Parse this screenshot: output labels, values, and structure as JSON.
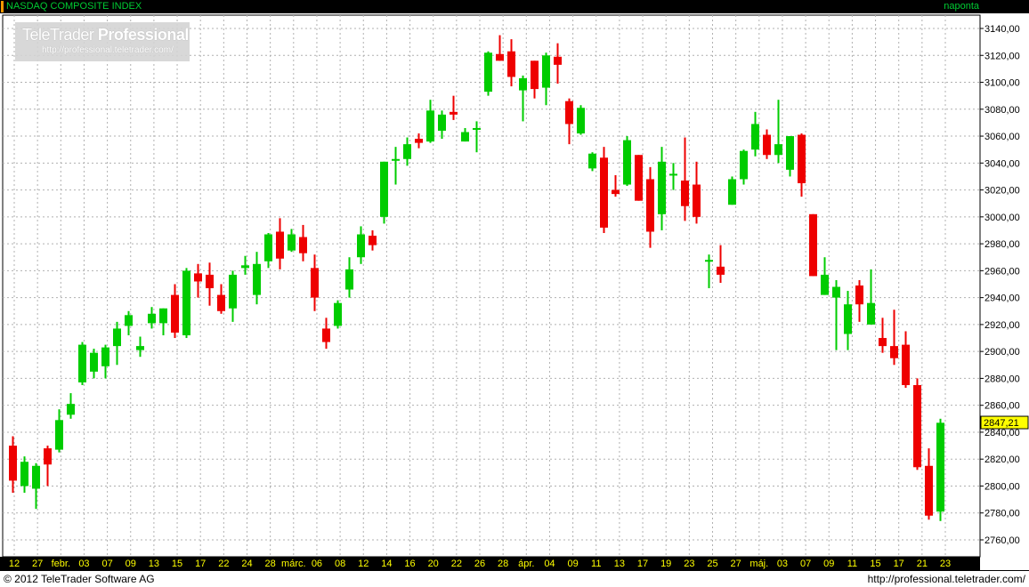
{
  "header": {
    "title": "NASDAQ COMPOSITE INDEX",
    "interval": "naponta"
  },
  "footer": {
    "copyright": "© 2012 TeleTrader Software AG",
    "url": "http://professional.teletrader.com/"
  },
  "watermark": {
    "brand": "TeleTrader",
    "brand_bold": "Professional",
    "url": "http://professional.teletrader.com/"
  },
  "colors": {
    "up": "#00cc00",
    "down": "#ee0000",
    "title_text": "#00cc33",
    "last_price_bg": "#ffff00",
    "accent": "#ff9900"
  },
  "chart_data": {
    "type": "candlestick",
    "y_axis": {
      "min": 2750,
      "max": 3150,
      "ticks": [
        2760,
        2780,
        2800,
        2820,
        2840,
        2860,
        2880,
        2900,
        2920,
        2940,
        2960,
        2980,
        3000,
        3020,
        3040,
        3060,
        3080,
        3100,
        3120,
        3140
      ],
      "tick_labels": [
        "2760,00",
        "2780,00",
        "2800,00",
        "2820,00",
        "2840,00",
        "2860,00",
        "2880,00",
        "2900,00",
        "2920,00",
        "2940,00",
        "2960,00",
        "2980,00",
        "3000,00",
        "3020,00",
        "3040,00",
        "3060,00",
        "3080,00",
        "3100,00",
        "3120,00",
        "3140,00"
      ],
      "position": "right",
      "grid": true
    },
    "x_axis": {
      "tick_labels": [
        "12",
        "27",
        "febr.",
        "03",
        "07",
        "09",
        "13",
        "15",
        "17",
        "22",
        "24",
        "28",
        "márc.",
        "06",
        "08",
        "12",
        "14",
        "16",
        "20",
        "22",
        "26",
        "28",
        "ápr.",
        "04",
        "09",
        "11",
        "13",
        "17",
        "19",
        "23",
        "25",
        "27",
        "máj.",
        "03",
        "07",
        "09",
        "11",
        "15",
        "17",
        "21",
        "23"
      ],
      "grid": true
    },
    "last_price": 2847.21,
    "last_price_label": "2847,21",
    "candles": [
      {
        "o": 2830,
        "h": 2837,
        "l": 2795,
        "c": 2804
      },
      {
        "o": 2800,
        "h": 2822,
        "l": 2795,
        "c": 2818
      },
      {
        "o": 2798,
        "h": 2817,
        "l": 2783,
        "c": 2815
      },
      {
        "o": 2828,
        "h": 2830,
        "l": 2800,
        "c": 2816
      },
      {
        "o": 2827,
        "h": 2857,
        "l": 2825,
        "c": 2849
      },
      {
        "o": 2853,
        "h": 2869,
        "l": 2850,
        "c": 2861
      },
      {
        "o": 2877,
        "h": 2907,
        "l": 2875,
        "c": 2905
      },
      {
        "o": 2885,
        "h": 2902,
        "l": 2880,
        "c": 2899
      },
      {
        "o": 2889,
        "h": 2905,
        "l": 2880,
        "c": 2903
      },
      {
        "o": 2904,
        "h": 2922,
        "l": 2890,
        "c": 2917
      },
      {
        "o": 2919,
        "h": 2930,
        "l": 2912,
        "c": 2927
      },
      {
        "o": 2901,
        "h": 2911,
        "l": 2896,
        "c": 2904
      },
      {
        "o": 2921,
        "h": 2933,
        "l": 2917,
        "c": 2928
      },
      {
        "o": 2921,
        "h": 2932,
        "l": 2912,
        "c": 2932
      },
      {
        "o": 2942,
        "h": 2950,
        "l": 2910,
        "c": 2914
      },
      {
        "o": 2912,
        "h": 2962,
        "l": 2910,
        "c": 2960
      },
      {
        "o": 2958,
        "h": 2965,
        "l": 2940,
        "c": 2952
      },
      {
        "o": 2957,
        "h": 2966,
        "l": 2934,
        "c": 2947
      },
      {
        "o": 2942,
        "h": 2950,
        "l": 2928,
        "c": 2930
      },
      {
        "o": 2932,
        "h": 2960,
        "l": 2922,
        "c": 2957
      },
      {
        "o": 2962,
        "h": 2971,
        "l": 2957,
        "c": 2964
      },
      {
        "o": 2942,
        "h": 2974,
        "l": 2935,
        "c": 2965
      },
      {
        "o": 2967,
        "h": 2988,
        "l": 2962,
        "c": 2987
      },
      {
        "o": 2989,
        "h": 2999,
        "l": 2961,
        "c": 2969
      },
      {
        "o": 2975,
        "h": 2991,
        "l": 2974,
        "c": 2987
      },
      {
        "o": 2985,
        "h": 2994,
        "l": 2967,
        "c": 2973
      },
      {
        "o": 2962,
        "h": 2972,
        "l": 2930,
        "c": 2940
      },
      {
        "o": 2917,
        "h": 2925,
        "l": 2902,
        "c": 2907
      },
      {
        "o": 2919,
        "h": 2938,
        "l": 2917,
        "c": 2936
      },
      {
        "o": 2946,
        "h": 2970,
        "l": 2940,
        "c": 2961
      },
      {
        "o": 2970,
        "h": 2993,
        "l": 2965,
        "c": 2987
      },
      {
        "o": 2986,
        "h": 2990,
        "l": 2975,
        "c": 2979
      },
      {
        "o": 3000,
        "h": 3041,
        "l": 2995,
        "c": 3041
      },
      {
        "o": 3043,
        "h": 3052,
        "l": 3024,
        "c": 3043
      },
      {
        "o": 3043,
        "h": 3059,
        "l": 3038,
        "c": 3054
      },
      {
        "o": 3058,
        "h": 3062,
        "l": 3051,
        "c": 3055
      },
      {
        "o": 3056,
        "h": 3087,
        "l": 3055,
        "c": 3079
      },
      {
        "o": 3064,
        "h": 3079,
        "l": 3058,
        "c": 3076
      },
      {
        "o": 3078,
        "h": 3090,
        "l": 3072,
        "c": 3076
      },
      {
        "o": 3056,
        "h": 3066,
        "l": 3057,
        "c": 3063
      },
      {
        "o": 3066,
        "h": 3071,
        "l": 3048,
        "c": 3066
      },
      {
        "o": 3093,
        "h": 3123,
        "l": 3090,
        "c": 3122
      },
      {
        "o": 3121,
        "h": 3135,
        "l": 3116,
        "c": 3116
      },
      {
        "o": 3123,
        "h": 3132,
        "l": 3097,
        "c": 3104
      },
      {
        "o": 3094,
        "h": 3105,
        "l": 3071,
        "c": 3103
      },
      {
        "o": 3116,
        "h": 3111,
        "l": 3088,
        "c": 3095
      },
      {
        "o": 3096,
        "h": 3122,
        "l": 3083,
        "c": 3120
      },
      {
        "o": 3119,
        "h": 3129,
        "l": 3099,
        "c": 3113
      },
      {
        "o": 3086,
        "h": 3088,
        "l": 3054,
        "c": 3069
      },
      {
        "o": 3062,
        "h": 3083,
        "l": 3061,
        "c": 3081
      },
      {
        "o": 3036,
        "h": 3048,
        "l": 3034,
        "c": 3047
      },
      {
        "o": 3044,
        "h": 3052,
        "l": 2988,
        "c": 2992
      },
      {
        "o": 3020,
        "h": 3031,
        "l": 3015,
        "c": 3017
      },
      {
        "o": 3024,
        "h": 3060,
        "l": 3023,
        "c": 3057
      },
      {
        "o": 3046,
        "h": 3046,
        "l": 3012,
        "c": 3012
      },
      {
        "o": 3028,
        "h": 3037,
        "l": 2977,
        "c": 2989
      },
      {
        "o": 3002,
        "h": 3052,
        "l": 2990,
        "c": 3041
      },
      {
        "o": 3032,
        "h": 3040,
        "l": 3020,
        "c": 3032
      },
      {
        "o": 3027,
        "h": 3059,
        "l": 2997,
        "c": 3008
      },
      {
        "o": 3024,
        "h": 3041,
        "l": 2995,
        "c": 3000
      },
      {
        "o": 2967,
        "h": 2972,
        "l": 2947,
        "c": 2968
      },
      {
        "o": 2963,
        "h": 2979,
        "l": 2951,
        "c": 2957
      },
      {
        "o": 3009,
        "h": 3030,
        "l": 3010,
        "c": 3028
      },
      {
        "o": 3028,
        "h": 3050,
        "l": 3024,
        "c": 3049
      },
      {
        "o": 3050,
        "h": 3078,
        "l": 3045,
        "c": 3069
      },
      {
        "o": 3061,
        "h": 3065,
        "l": 3043,
        "c": 3046
      },
      {
        "o": 3046,
        "h": 3087,
        "l": 3040,
        "c": 3054
      },
      {
        "o": 3035,
        "h": 3060,
        "l": 3030,
        "c": 3060
      },
      {
        "o": 3061,
        "h": 3062,
        "l": 3015,
        "c": 3025
      },
      {
        "o": 3002,
        "h": 3002,
        "l": 2956,
        "c": 2956
      },
      {
        "o": 2942,
        "h": 2970,
        "l": 2942,
        "c": 2957
      },
      {
        "o": 2940,
        "h": 2953,
        "l": 2901,
        "c": 2948
      },
      {
        "o": 2913,
        "h": 2945,
        "l": 2901,
        "c": 2935
      },
      {
        "o": 2949,
        "h": 2953,
        "l": 2922,
        "c": 2935
      },
      {
        "o": 2920,
        "h": 2961,
        "l": 2922,
        "c": 2936
      },
      {
        "o": 2910,
        "h": 2925,
        "l": 2899,
        "c": 2904
      },
      {
        "o": 2904,
        "h": 2931,
        "l": 2890,
        "c": 2895
      },
      {
        "o": 2905,
        "h": 2915,
        "l": 2873,
        "c": 2875
      },
      {
        "o": 2875,
        "h": 2880,
        "l": 2812,
        "c": 2814
      },
      {
        "o": 2815,
        "h": 2828,
        "l": 2775,
        "c": 2778
      },
      {
        "o": 2781,
        "h": 2850,
        "l": 2774,
        "c": 2847
      }
    ]
  }
}
